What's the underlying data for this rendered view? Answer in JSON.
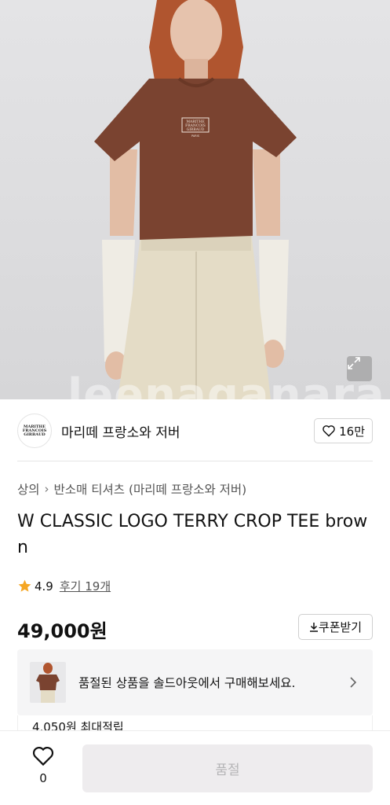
{
  "hero": {
    "watermark": "leenaganara",
    "shirt_logo": [
      "MARITHE",
      "FRANCOIS",
      "GIRBAUD",
      "PARIS"
    ],
    "expand_icon": "expand-icon"
  },
  "brand": {
    "logo_text": [
      "MARITHE",
      "FRANCOIS",
      "GIRBAUD"
    ],
    "name": "마리떼 프랑소와 저버",
    "like_count": "16만"
  },
  "breadcrumb": {
    "category": "상의",
    "subcategory": "반소매 티셔츠 (마리떼 프랑소와 저버)"
  },
  "product": {
    "title": "W CLASSIC LOGO TERRY CROP TEE brown",
    "rating": "4.9",
    "reviews": "후기 19개",
    "price": "49,000원",
    "coupon_label": "쿠폰받기"
  },
  "soldout_banner": {
    "text": "품절된 상품을 솔드아웃에서 구매해보세요."
  },
  "points": "4,050원 최대적립",
  "bottom_bar": {
    "wish_count": "0",
    "buy_label": "품절"
  },
  "colors": {
    "accent_star": "#f5a623",
    "shirt": "#7a4330",
    "pants": "#e4dcc6",
    "disabled_button": "#eeecee"
  }
}
